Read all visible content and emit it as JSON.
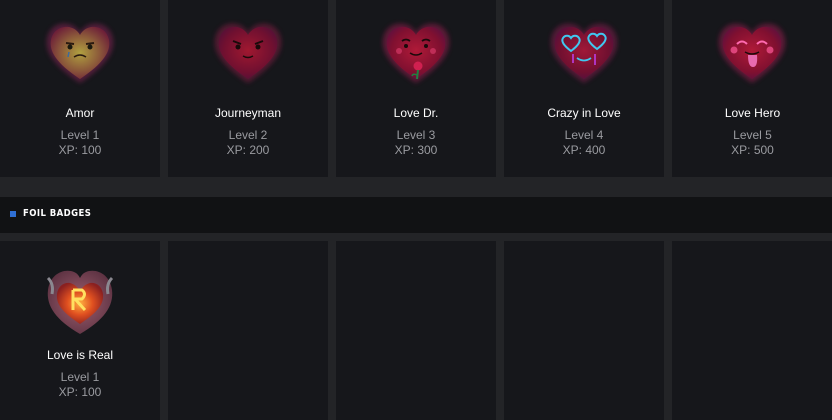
{
  "badges": [
    {
      "name": "Amor",
      "level": "Level 1",
      "xp": "XP: 100",
      "icon": "amor-heart-icon"
    },
    {
      "name": "Journeyman",
      "level": "Level 2",
      "xp": "XP: 200",
      "icon": "journeyman-heart-icon"
    },
    {
      "name": "Love Dr.",
      "level": "Level 3",
      "xp": "XP: 300",
      "icon": "love-dr-heart-icon"
    },
    {
      "name": "Crazy in Love",
      "level": "Level 4",
      "xp": "XP: 400",
      "icon": "crazy-in-love-heart-icon"
    },
    {
      "name": "Love Hero",
      "level": "Level 5",
      "xp": "XP: 500",
      "icon": "love-hero-heart-icon"
    }
  ],
  "foil_section": {
    "title": "FOIL BADGES",
    "badges": [
      {
        "name": "Love is Real",
        "level": "Level 1",
        "xp": "XP: 100",
        "icon": "love-is-real-foil-heart-icon"
      }
    ]
  },
  "colors": {
    "accent": "#2f6fd3",
    "card_bg": "#16171b",
    "page_bg": "#232427",
    "header_bg": "#111214"
  }
}
